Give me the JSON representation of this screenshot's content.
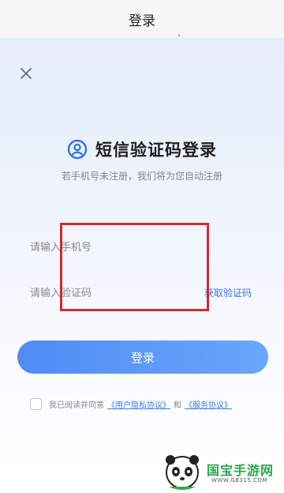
{
  "topbar": {
    "title": "登录"
  },
  "heading": {
    "title": "短信验证码登录",
    "subtitle": "若手机号未注册，我们将为您自动注册"
  },
  "form": {
    "phone_placeholder": "请输入手机号",
    "code_placeholder": "请输入验证码",
    "get_code_label": "获取验证码",
    "login_label": "登录"
  },
  "agreement": {
    "prefix": "我已阅读并同意",
    "privacy_link": "《用户隐私协议》",
    "and": "和",
    "service_link": "《服务协议》"
  },
  "icons": {
    "close": "close-icon",
    "user": "user-circle-icon"
  },
  "watermark": {
    "text": "国宝手游网",
    "url": "WWW.GB315.COM"
  },
  "colors": {
    "accent": "#3b7ae6",
    "button_start": "#4f8cf4",
    "button_end": "#6aa6fb",
    "highlight": "#d42a2a"
  }
}
